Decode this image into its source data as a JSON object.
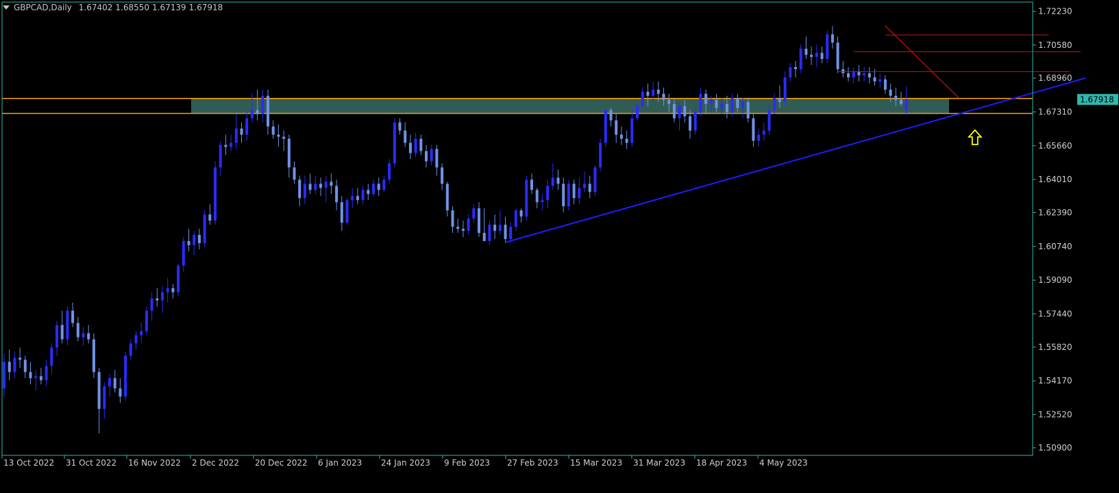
{
  "header": {
    "symbol": "GBPCAD,Daily",
    "open": "1.67402",
    "high": "1.68550",
    "low": "1.67139",
    "close": "1.67918"
  },
  "current_price_label": "1.67918",
  "colors": {
    "background": "#000000",
    "axis": "#2fb7ae",
    "candle_bull": "#2b2bff",
    "candle_bear": "#6f94e6",
    "zone_fill": "#3a6c64",
    "zone_border": "#ffa500",
    "trendline": "#1d1dff",
    "resistance": "#c81414",
    "arrow": "#ffff00",
    "price_tag_bg": "#2fb7ae"
  },
  "chart_data": {
    "type": "candlestick",
    "y_ticks": [
      "1.72230",
      "1.70580",
      "1.68960",
      "1.67310",
      "1.65660",
      "1.64010",
      "1.62390",
      "1.60740",
      "1.59090",
      "1.57440",
      "1.55820",
      "1.54170",
      "1.52520",
      "1.50900"
    ],
    "x_ticks": [
      "13 Oct 2022",
      "31 Oct 2022",
      "16 Nov 2022",
      "2 Dec 2022",
      "20 Dec 2022",
      "6 Jan 2023",
      "24 Jan 2023",
      "9 Feb 2023",
      "27 Feb 2023",
      "15 Mar 2023",
      "31 Mar 2023",
      "18 Apr 2023",
      "4 May 2023"
    ],
    "ylim": [
      1.5053,
      1.7268
    ],
    "zone": {
      "top": 1.6797,
      "bottom": 1.6724
    },
    "annotations": {
      "trendline": {
        "from": [
          95,
          1.6094
        ],
        "to": [
          205,
          1.6897
        ]
      },
      "down_line": {
        "from": [
          167,
          1.7152
        ],
        "to": [
          181,
          1.6798
        ]
      },
      "resistance_levels": [
        {
          "price": 1.7107,
          "from": 167,
          "to": 198
        },
        {
          "price": 1.7025,
          "from": 161,
          "to": 204
        },
        {
          "price": 1.6928,
          "from": 158,
          "to": 202
        }
      ],
      "arrow_at": 184
    },
    "ohlc": [
      [
        1.538,
        1.555,
        1.534,
        1.551
      ],
      [
        1.551,
        1.557,
        1.542,
        1.546
      ],
      [
        1.546,
        1.556,
        1.543,
        1.553
      ],
      [
        1.553,
        1.558,
        1.548,
        1.552
      ],
      [
        1.552,
        1.554,
        1.543,
        1.546
      ],
      [
        1.546,
        1.551,
        1.54,
        1.543
      ],
      [
        1.543,
        1.547,
        1.537,
        1.544
      ],
      [
        1.544,
        1.548,
        1.54,
        1.542
      ],
      [
        1.542,
        1.552,
        1.539,
        1.549
      ],
      [
        1.549,
        1.56,
        1.545,
        1.558
      ],
      [
        1.558,
        1.571,
        1.554,
        1.569
      ],
      [
        1.569,
        1.576,
        1.56,
        1.562
      ],
      [
        1.562,
        1.578,
        1.559,
        1.576
      ],
      [
        1.576,
        1.58,
        1.568,
        1.57
      ],
      [
        1.57,
        1.573,
        1.561,
        1.563
      ],
      [
        1.563,
        1.568,
        1.559,
        1.565
      ],
      [
        1.565,
        1.569,
        1.56,
        1.562
      ],
      [
        1.562,
        1.565,
        1.543,
        1.546
      ],
      [
        1.546,
        1.548,
        1.516,
        1.528
      ],
      [
        1.528,
        1.541,
        1.523,
        1.539
      ],
      [
        1.539,
        1.545,
        1.534,
        1.543
      ],
      [
        1.543,
        1.547,
        1.536,
        1.538
      ],
      [
        1.538,
        1.543,
        1.531,
        1.534
      ],
      [
        1.534,
        1.556,
        1.532,
        1.554
      ],
      [
        1.554,
        1.562,
        1.552,
        1.56
      ],
      [
        1.56,
        1.566,
        1.557,
        1.564
      ],
      [
        1.564,
        1.57,
        1.56,
        1.566
      ],
      [
        1.566,
        1.578,
        1.564,
        1.576
      ],
      [
        1.576,
        1.585,
        1.571,
        1.582
      ],
      [
        1.582,
        1.587,
        1.578,
        1.581
      ],
      [
        1.581,
        1.588,
        1.575,
        1.585
      ],
      [
        1.585,
        1.592,
        1.58,
        1.587
      ],
      [
        1.587,
        1.589,
        1.582,
        1.585
      ],
      [
        1.585,
        1.599,
        1.583,
        1.598
      ],
      [
        1.598,
        1.612,
        1.595,
        1.61
      ],
      [
        1.61,
        1.616,
        1.605,
        1.608
      ],
      [
        1.608,
        1.615,
        1.603,
        1.613
      ],
      [
        1.613,
        1.616,
        1.606,
        1.609
      ],
      [
        1.609,
        1.625,
        1.607,
        1.623
      ],
      [
        1.623,
        1.628,
        1.618,
        1.62
      ],
      [
        1.62,
        1.649,
        1.618,
        1.646
      ],
      [
        1.646,
        1.659,
        1.642,
        1.657
      ],
      [
        1.657,
        1.662,
        1.652,
        1.656
      ],
      [
        1.656,
        1.662,
        1.654,
        1.658
      ],
      [
        1.658,
        1.672,
        1.655,
        1.665
      ],
      [
        1.665,
        1.668,
        1.658,
        1.662
      ],
      [
        1.662,
        1.673,
        1.659,
        1.67
      ],
      [
        1.67,
        1.682,
        1.668,
        1.674
      ],
      [
        1.674,
        1.684,
        1.669,
        1.672
      ],
      [
        1.672,
        1.684,
        1.668,
        1.681
      ],
      [
        1.681,
        1.684,
        1.662,
        1.666
      ],
      [
        1.666,
        1.669,
        1.66,
        1.662
      ],
      [
        1.662,
        1.667,
        1.656,
        1.661
      ],
      [
        1.661,
        1.664,
        1.654,
        1.66
      ],
      [
        1.66,
        1.662,
        1.641,
        1.646
      ],
      [
        1.646,
        1.649,
        1.638,
        1.64
      ],
      [
        1.64,
        1.642,
        1.627,
        1.631
      ],
      [
        1.631,
        1.642,
        1.628,
        1.638
      ],
      [
        1.638,
        1.643,
        1.633,
        1.635
      ],
      [
        1.635,
        1.642,
        1.633,
        1.638
      ],
      [
        1.638,
        1.641,
        1.632,
        1.636
      ],
      [
        1.636,
        1.642,
        1.629,
        1.639
      ],
      [
        1.639,
        1.643,
        1.633,
        1.637
      ],
      [
        1.637,
        1.64,
        1.625,
        1.629
      ],
      [
        1.629,
        1.632,
        1.615,
        1.619
      ],
      [
        1.619,
        1.631,
        1.618,
        1.63
      ],
      [
        1.63,
        1.636,
        1.626,
        1.632
      ],
      [
        1.632,
        1.636,
        1.628,
        1.63
      ],
      [
        1.63,
        1.637,
        1.628,
        1.635
      ],
      [
        1.635,
        1.638,
        1.63,
        1.633
      ],
      [
        1.633,
        1.64,
        1.632,
        1.638
      ],
      [
        1.638,
        1.641,
        1.632,
        1.635
      ],
      [
        1.635,
        1.642,
        1.634,
        1.64
      ],
      [
        1.64,
        1.65,
        1.638,
        1.648
      ],
      [
        1.648,
        1.67,
        1.646,
        1.668
      ],
      [
        1.668,
        1.67,
        1.662,
        1.664
      ],
      [
        1.664,
        1.668,
        1.656,
        1.658
      ],
      [
        1.658,
        1.662,
        1.65,
        1.653
      ],
      [
        1.653,
        1.663,
        1.651,
        1.66
      ],
      [
        1.66,
        1.662,
        1.652,
        1.654
      ],
      [
        1.654,
        1.657,
        1.646,
        1.649
      ],
      [
        1.649,
        1.657,
        1.647,
        1.655
      ],
      [
        1.655,
        1.657,
        1.642,
        1.646
      ],
      [
        1.646,
        1.648,
        1.635,
        1.638
      ],
      [
        1.638,
        1.639,
        1.622,
        1.625
      ],
      [
        1.625,
        1.627,
        1.614,
        1.617
      ],
      [
        1.617,
        1.621,
        1.614,
        1.616
      ],
      [
        1.616,
        1.62,
        1.612,
        1.615
      ],
      [
        1.615,
        1.623,
        1.613,
        1.621
      ],
      [
        1.621,
        1.628,
        1.619,
        1.626
      ],
      [
        1.626,
        1.629,
        1.612,
        1.614
      ],
      [
        1.614,
        1.626,
        1.61,
        1.61
      ],
      [
        1.61,
        1.62,
        1.608,
        1.618
      ],
      [
        1.618,
        1.623,
        1.611,
        1.615
      ],
      [
        1.615,
        1.625,
        1.613,
        1.618
      ],
      [
        1.618,
        1.622,
        1.609,
        1.611
      ],
      [
        1.611,
        1.619,
        1.609,
        1.617
      ],
      [
        1.617,
        1.626,
        1.615,
        1.625
      ],
      [
        1.625,
        1.626,
        1.619,
        1.622
      ],
      [
        1.622,
        1.642,
        1.62,
        1.64
      ],
      [
        1.64,
        1.643,
        1.633,
        1.635
      ],
      [
        1.635,
        1.636,
        1.626,
        1.629
      ],
      [
        1.629,
        1.633,
        1.625,
        1.63
      ],
      [
        1.63,
        1.64,
        1.626,
        1.637
      ],
      [
        1.637,
        1.648,
        1.635,
        1.641
      ],
      [
        1.641,
        1.645,
        1.635,
        1.638
      ],
      [
        1.638,
        1.641,
        1.624,
        1.627
      ],
      [
        1.627,
        1.64,
        1.625,
        1.638
      ],
      [
        1.638,
        1.64,
        1.628,
        1.631
      ],
      [
        1.631,
        1.641,
        1.628,
        1.636
      ],
      [
        1.636,
        1.644,
        1.634,
        1.638
      ],
      [
        1.638,
        1.642,
        1.631,
        1.634
      ],
      [
        1.634,
        1.647,
        1.632,
        1.646
      ],
      [
        1.646,
        1.66,
        1.644,
        1.658
      ],
      [
        1.658,
        1.674,
        1.656,
        1.674
      ],
      [
        1.674,
        1.675,
        1.666,
        1.669
      ],
      [
        1.669,
        1.672,
        1.658,
        1.662
      ],
      [
        1.662,
        1.666,
        1.657,
        1.66
      ],
      [
        1.66,
        1.664,
        1.655,
        1.658
      ],
      [
        1.658,
        1.674,
        1.656,
        1.67
      ],
      [
        1.67,
        1.678,
        1.669,
        1.676
      ],
      [
        1.676,
        1.685,
        1.675,
        1.683
      ],
      [
        1.683,
        1.687,
        1.676,
        1.681
      ],
      [
        1.681,
        1.688,
        1.678,
        1.684
      ],
      [
        1.684,
        1.688,
        1.678,
        1.682
      ],
      [
        1.682,
        1.685,
        1.676,
        1.679
      ],
      [
        1.679,
        1.682,
        1.673,
        1.677
      ],
      [
        1.677,
        1.68,
        1.668,
        1.67
      ],
      [
        1.67,
        1.678,
        1.664,
        1.676
      ],
      [
        1.676,
        1.679,
        1.668,
        1.671
      ],
      [
        1.671,
        1.674,
        1.66,
        1.664
      ],
      [
        1.664,
        1.676,
        1.662,
        1.673
      ],
      [
        1.673,
        1.685,
        1.671,
        1.682
      ],
      [
        1.682,
        1.684,
        1.672,
        1.677
      ],
      [
        1.677,
        1.681,
        1.673,
        1.679
      ],
      [
        1.679,
        1.682,
        1.673,
        1.675
      ],
      [
        1.675,
        1.68,
        1.672,
        1.677
      ],
      [
        1.677,
        1.681,
        1.67,
        1.673
      ],
      [
        1.673,
        1.682,
        1.671,
        1.68
      ],
      [
        1.68,
        1.682,
        1.673,
        1.675
      ],
      [
        1.675,
        1.68,
        1.67,
        1.678
      ],
      [
        1.678,
        1.68,
        1.668,
        1.67
      ],
      [
        1.67,
        1.672,
        1.656,
        1.659
      ],
      [
        1.659,
        1.665,
        1.656,
        1.662
      ],
      [
        1.662,
        1.668,
        1.659,
        1.664
      ],
      [
        1.664,
        1.676,
        1.662,
        1.674
      ],
      [
        1.674,
        1.682,
        1.672,
        1.68
      ],
      [
        1.68,
        1.686,
        1.675,
        1.678
      ],
      [
        1.678,
        1.693,
        1.676,
        1.69
      ],
      [
        1.69,
        1.697,
        1.688,
        1.695
      ],
      [
        1.695,
        1.698,
        1.69,
        1.694
      ],
      [
        1.694,
        1.706,
        1.692,
        1.704
      ],
      [
        1.704,
        1.71,
        1.699,
        1.701
      ],
      [
        1.701,
        1.705,
        1.696,
        1.7
      ],
      [
        1.7,
        1.706,
        1.695,
        1.702
      ],
      [
        1.702,
        1.705,
        1.697,
        1.699
      ],
      [
        1.699,
        1.713,
        1.697,
        1.711
      ],
      [
        1.711,
        1.715,
        1.704,
        1.707
      ],
      [
        1.707,
        1.71,
        1.692,
        1.694
      ],
      [
        1.694,
        1.698,
        1.69,
        1.692
      ],
      [
        1.692,
        1.695,
        1.688,
        1.69
      ],
      [
        1.69,
        1.695,
        1.687,
        1.693
      ],
      [
        1.693,
        1.696,
        1.688,
        1.691
      ],
      [
        1.691,
        1.695,
        1.688,
        1.692
      ],
      [
        1.692,
        1.695,
        1.687,
        1.69
      ],
      [
        1.69,
        1.694,
        1.686,
        1.688
      ],
      [
        1.688,
        1.692,
        1.685,
        1.689
      ],
      [
        1.689,
        1.691,
        1.682,
        1.684
      ],
      [
        1.684,
        1.687,
        1.678,
        1.681
      ],
      [
        1.681,
        1.685,
        1.676,
        1.679
      ],
      [
        1.679,
        1.683,
        1.676,
        1.677
      ],
      [
        1.674,
        1.6855,
        1.6714,
        1.6792
      ]
    ]
  }
}
